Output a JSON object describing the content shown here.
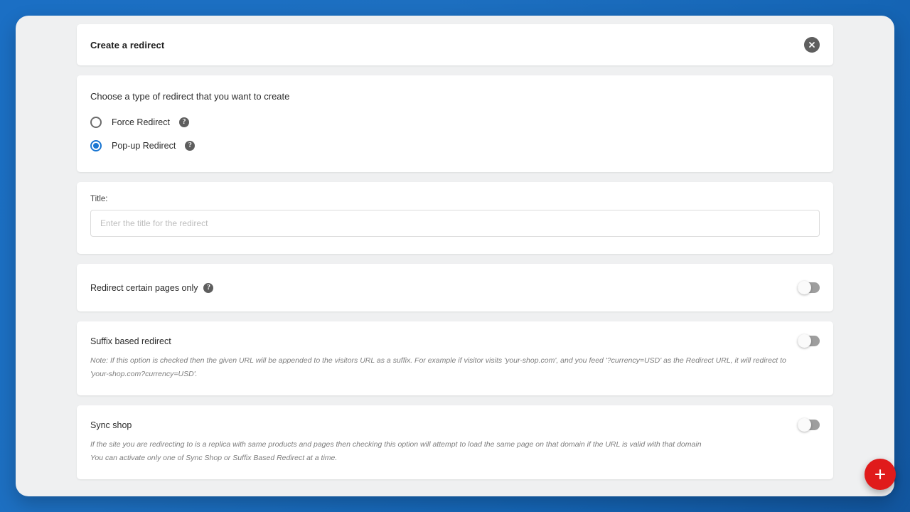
{
  "header": {
    "title": "Create a redirect",
    "close_icon": "close-circle-icon"
  },
  "redirect_type": {
    "prompt": "Choose a type of redirect that you want to create",
    "options": [
      {
        "label": "Force Redirect",
        "selected": false,
        "help_icon": "help-circle-icon"
      },
      {
        "label": "Pop-up Redirect",
        "selected": true,
        "help_icon": "help-circle-icon"
      }
    ]
  },
  "title_field": {
    "label": "Title:",
    "value": "",
    "placeholder": "Enter the title for the redirect"
  },
  "certain_pages": {
    "title": "Redirect certain pages only",
    "help_icon": "help-circle-icon",
    "toggle_state": "off"
  },
  "suffix_redirect": {
    "title": "Suffix based redirect",
    "toggle_state": "off",
    "note_line_1": "Note: If this option is checked then the given URL will be appended to the visitors URL as a suffix. For example if visitor visits 'your-shop.com', and you feed '?currency=USD' as the Redirect URL, it will redirect to",
    "note_line_2": "'your-shop.com?currency=USD'."
  },
  "sync_shop": {
    "title": "Sync shop",
    "toggle_state": "off",
    "note_line_1": "If the site you are redirecting to is a replica with same products and pages then checking this option will attempt to load the same page on that domain if the URL is valid with that domain",
    "note_line_2": "You can activate only one of Sync Shop or Suffix Based Redirect at a time."
  },
  "fab": {
    "icon": "plus-icon",
    "color": "#e01b1b"
  },
  "theme": {
    "background_blue": "#1b6fc4",
    "surface": "#eff0f1",
    "card": "#ffffff",
    "accent_blue": "#1976d2"
  }
}
